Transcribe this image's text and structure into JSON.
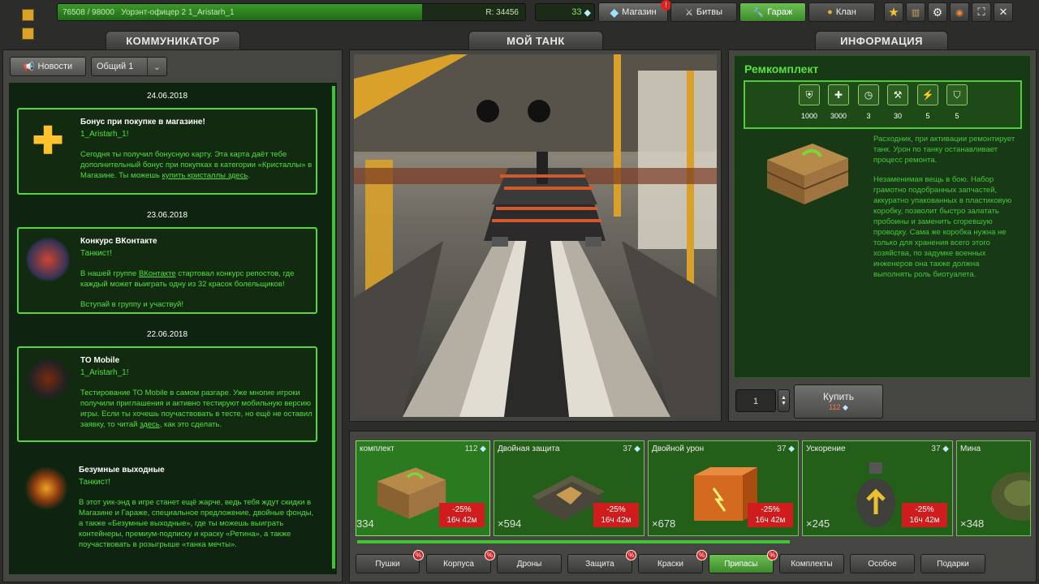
{
  "topbar": {
    "progress_text": "76508 / 98000",
    "rank": "Уорэнт-офицер 2",
    "username": "1_Aristarh_1",
    "rating": "R: 34456",
    "progress": 0.78,
    "crystals": "33",
    "shop": "Магазин",
    "shop_alert": "!",
    "battles": "Битвы",
    "garage": "Гараж",
    "clan": "Клан"
  },
  "communicator": {
    "title": "КОММУНИКАТОР",
    "news_btn": "Новости",
    "channel": "Общий 1",
    "items": [
      {
        "date": "24.06.2018",
        "title": "Бонус при покупке в магазине!",
        "greet": "1_Aristarh_1!",
        "body": "Сегодня ты получил бонусную карту. Эта карта даёт тебе дополнительный бонус при покупках в категории «Кристаллы» в Магазине. Ты можешь ",
        "link": "купить кристаллы здесь",
        "tail": "."
      },
      {
        "date": "23.06.2018",
        "title": "Конкурс ВКонтакте",
        "greet": "Танкист!",
        "body_pre": "В нашей группе ",
        "link": "ВКонтакте",
        "body": " стартовал конкурс репостов, где каждый может выиграть одну из 32 красок болельщиков!",
        "tail": "Вступай в группу и участвуй!"
      },
      {
        "date": "22.06.2018",
        "title": "TO Mobile",
        "greet": "1_Aristarh_1!",
        "body": "Тестирование ТО Mobile в самом разгаре. Уже многие игроки получили приглашения и активно тестируют мобильную версию игры. Если ты хочешь поучаствовать в тесте, но ещё не оставил заявку, то читай ",
        "link": "здесь",
        "tail": ", как это сделать."
      },
      {
        "title": "Безумные выходные",
        "greet": "Танкист!",
        "body": "В этот уик-энд в игре станет ещё жарче, ведь тебя ждут скидки в Магазине и Гараже, специальное предложение, двойные фонды, а также «Безумные выходные», где ты можешь выиграть контейнеры, премиум-подписку и краску «Ретина», а также поучаствовать в розыгрыше «танка мечты»."
      }
    ]
  },
  "mytank": {
    "title": "МОЙ ТАНК"
  },
  "info": {
    "title": "ИНФОРМАЦИЯ",
    "item_name": "Ремкомплект",
    "stats": [
      "1000",
      "3000",
      "3",
      "30",
      "5",
      "5"
    ],
    "desc1": "Расходник, при активации ремонтирует танк. Урон по танку останавливает процесс ремонта.",
    "desc2": "Незаменимая вещь в бою. Набор грамотно подобранных запчастей, аккуратно упакованных в пластиковую коробку, позволит быстро залатать пробоины и заменить сгоревшую проводку. Сама же коробка нужна не только для хранения всего этого хозяйства, по задумке военных инженеров она также должна выполнять роль биотуалета.",
    "qty": "1",
    "buy": "Купить",
    "price": "112"
  },
  "supplies": [
    {
      "name": "комплект",
      "price": "112",
      "qty": "334",
      "sale": "-25%",
      "time": "16ч 42м"
    },
    {
      "name": "Двойная защита",
      "price": "37",
      "qty": "×594",
      "sale": "-25%",
      "time": "16ч 42м"
    },
    {
      "name": "Двойной урон",
      "price": "37",
      "qty": "×678",
      "sale": "-25%",
      "time": "16ч 42м"
    },
    {
      "name": "Ускорение",
      "price": "37",
      "qty": "×245",
      "sale": "-25%",
      "time": "16ч 42м"
    },
    {
      "name": "Мина",
      "qty": "×348"
    }
  ],
  "tabs": [
    "Пушки",
    "Корпуса",
    "Дроны",
    "Защита",
    "Краски",
    "Припасы",
    "Комплекты",
    "Особое",
    "Подарки"
  ],
  "tab_disc": "%"
}
